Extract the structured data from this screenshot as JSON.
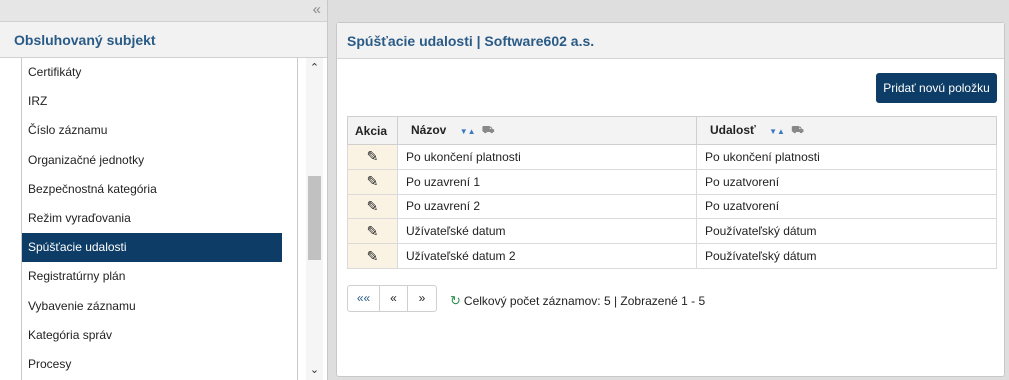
{
  "left": {
    "collapse_glyph": "«",
    "header": "Obsluhovaný subjekt",
    "items": [
      {
        "label": "Certifikáty",
        "active": false
      },
      {
        "label": "IRZ",
        "active": false
      },
      {
        "label": "Číslo záznamu",
        "active": false
      },
      {
        "label": "Organizačné jednotky",
        "active": false
      },
      {
        "label": "Bezpečnostná kategória",
        "active": false
      },
      {
        "label": "Režim vyraďovania",
        "active": false
      },
      {
        "label": "Spúšťacie udalosti",
        "active": true
      },
      {
        "label": "Registratúrny plán",
        "active": false
      },
      {
        "label": "Vybavenie záznamu",
        "active": false
      },
      {
        "label": "Kategória správ",
        "active": false
      },
      {
        "label": "Procesy",
        "active": false
      }
    ]
  },
  "right": {
    "header": "Spúšťacie udalosti | Software602 a.s.",
    "add_button": "Pridať novú položku",
    "columns": {
      "akcia": "Akcia",
      "nazov": "Názov",
      "udalost": "Udalosť"
    },
    "rows": [
      {
        "nazov": "Po ukončení platnosti",
        "udalost": "Po ukončení platnosti"
      },
      {
        "nazov": "Po uzavrení 1",
        "udalost": "Po uzatvorení"
      },
      {
        "nazov": "Po uzavrení 2",
        "udalost": "Po uzatvorení"
      },
      {
        "nazov": "Užívateľské datum",
        "udalost": "Používateľský dátum"
      },
      {
        "nazov": "Užívateľské datum 2",
        "udalost": "Používateľský dátum"
      }
    ],
    "pager": {
      "first": "««",
      "prev": "«",
      "next": "»"
    },
    "status": "Celkový počet záznamov: 5 | Zobrazené 1 - 5"
  },
  "icons": {
    "edit": "pencil-icon",
    "sort": "sort-icon",
    "filter": "filter-icon",
    "refresh": "refresh-icon",
    "collapse": "double-chevron-left-icon"
  },
  "colors": {
    "accent": "#0d3d66",
    "header_text": "#2a5b87",
    "action_cell": "#faf3e4"
  }
}
